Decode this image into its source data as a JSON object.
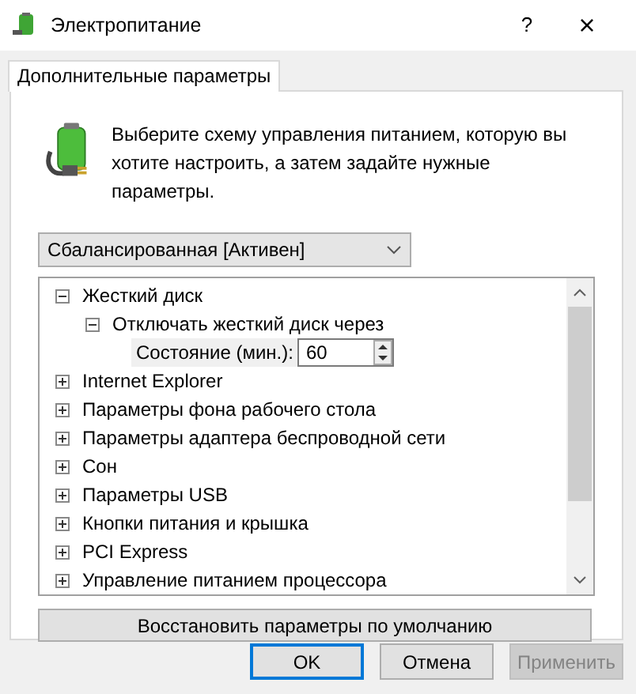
{
  "window": {
    "title": "Электропитание",
    "help": "?",
    "close": "×"
  },
  "tabs": [
    {
      "label": "Дополнительные параметры",
      "selected": true
    }
  ],
  "description": "Выберите схему управления питанием, которую вы хотите настроить, а затем задайте нужные параметры.",
  "scheme_dropdown": {
    "value": "Сбалансированная [Активен]"
  },
  "tree": [
    {
      "label": "Жесткий диск",
      "expanded": true,
      "children": [
        {
          "label": "Отключать жесткий диск через",
          "expanded": true,
          "children": [
            {
              "kind": "setting",
              "label": "Состояние (мин.):",
              "value": "60"
            }
          ]
        }
      ]
    },
    {
      "label": "Internet Explorer",
      "expanded": false
    },
    {
      "label": "Параметры фона рабочего стола",
      "expanded": false
    },
    {
      "label": "Параметры адаптера беспроводной сети",
      "expanded": false
    },
    {
      "label": "Сон",
      "expanded": false
    },
    {
      "label": "Параметры USB",
      "expanded": false
    },
    {
      "label": "Кнопки питания и крышка",
      "expanded": false
    },
    {
      "label": "PCI Express",
      "expanded": false
    },
    {
      "label": "Управление питанием процессора",
      "expanded": false
    }
  ],
  "restore_button": "Восстановить параметры по умолчанию",
  "buttons": [
    {
      "label": "OK",
      "default": true,
      "disabled": false
    },
    {
      "label": "Отмена",
      "default": false,
      "disabled": false
    },
    {
      "label": "Применить",
      "default": false,
      "disabled": true
    }
  ]
}
